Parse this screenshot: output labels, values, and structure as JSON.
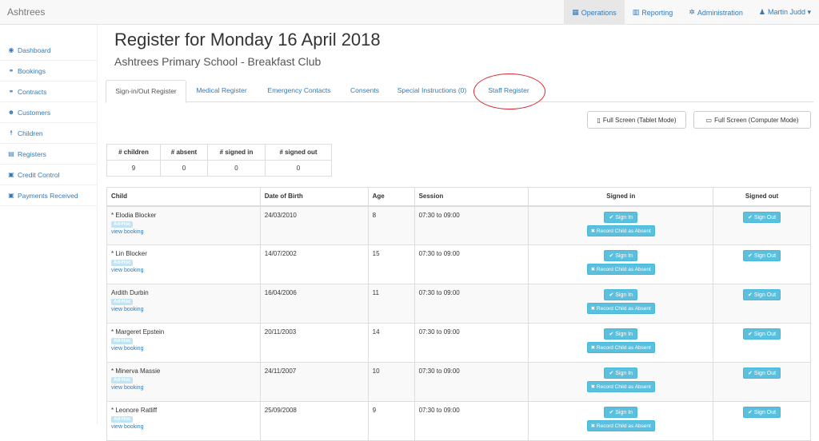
{
  "brand": "Ashtrees",
  "nav": [
    {
      "icon": "▦",
      "label": "Operations"
    },
    {
      "icon": "▥",
      "label": "Reporting"
    },
    {
      "icon": "✲",
      "label": "Administration"
    },
    {
      "icon": "♟",
      "label": "Martin Judd ▾"
    }
  ],
  "sidebar": [
    {
      "icon": "◉",
      "label": "Dashboard"
    },
    {
      "icon": "⚭",
      "label": "Bookings"
    },
    {
      "icon": "⚭",
      "label": "Contracts"
    },
    {
      "icon": "☻",
      "label": "Customers"
    },
    {
      "icon": "☨",
      "label": "Children"
    },
    {
      "icon": "▤",
      "label": "Registers"
    },
    {
      "icon": "▣",
      "label": "Credit Control"
    },
    {
      "icon": "▣",
      "label": "Payments Received"
    }
  ],
  "title": "Register for Monday 16 April 2018",
  "subtitle": "Ashtrees Primary School - Breakfast Club",
  "tabs": [
    "Sign-in/Out Register",
    "Medical Register",
    "Emergency Contacts",
    "Consents",
    "Special Instructions (0)",
    "Staff Register"
  ],
  "buttons": {
    "tablet": "Full Screen (Tablet Mode)",
    "computer": "Full Screen (Computer Mode)"
  },
  "summary": {
    "headers": [
      "# children",
      "# absent",
      "# signed in",
      "# signed out"
    ],
    "values": [
      "9",
      "0",
      "0",
      "0"
    ]
  },
  "register": {
    "headers": [
      "Child",
      "Date of Birth",
      "Age",
      "Session",
      "Signed in",
      "Signed out"
    ],
    "adhoc_label": "Ad-Hoc",
    "view_booking_label": "view booking",
    "sign_in_label": "✔ Sign In",
    "absent_label": "✖ Record Child as Absent",
    "sign_out_label": "✔ Sign Out",
    "rows": [
      {
        "name": "*  Elodia Blocker",
        "dob": "24/03/2010",
        "age": "8",
        "session": "07:30 to 09:00"
      },
      {
        "name": "*  Lin Blocker",
        "dob": "14/07/2002",
        "age": "15",
        "session": "07:30 to 09:00"
      },
      {
        "name": "Ardith Durbin",
        "dob": "16/04/2006",
        "age": "11",
        "session": "07:30 to 09:00"
      },
      {
        "name": "*  Margeret Epstein",
        "dob": "20/11/2003",
        "age": "14",
        "session": "07:30 to 09:00"
      },
      {
        "name": "*  Minerva Massie",
        "dob": "24/11/2007",
        "age": "10",
        "session": "07:30 to 09:00"
      },
      {
        "name": "*  Leonore Ratliff",
        "dob": "25/09/2008",
        "age": "9",
        "session": "07:30 to 09:00"
      }
    ]
  }
}
